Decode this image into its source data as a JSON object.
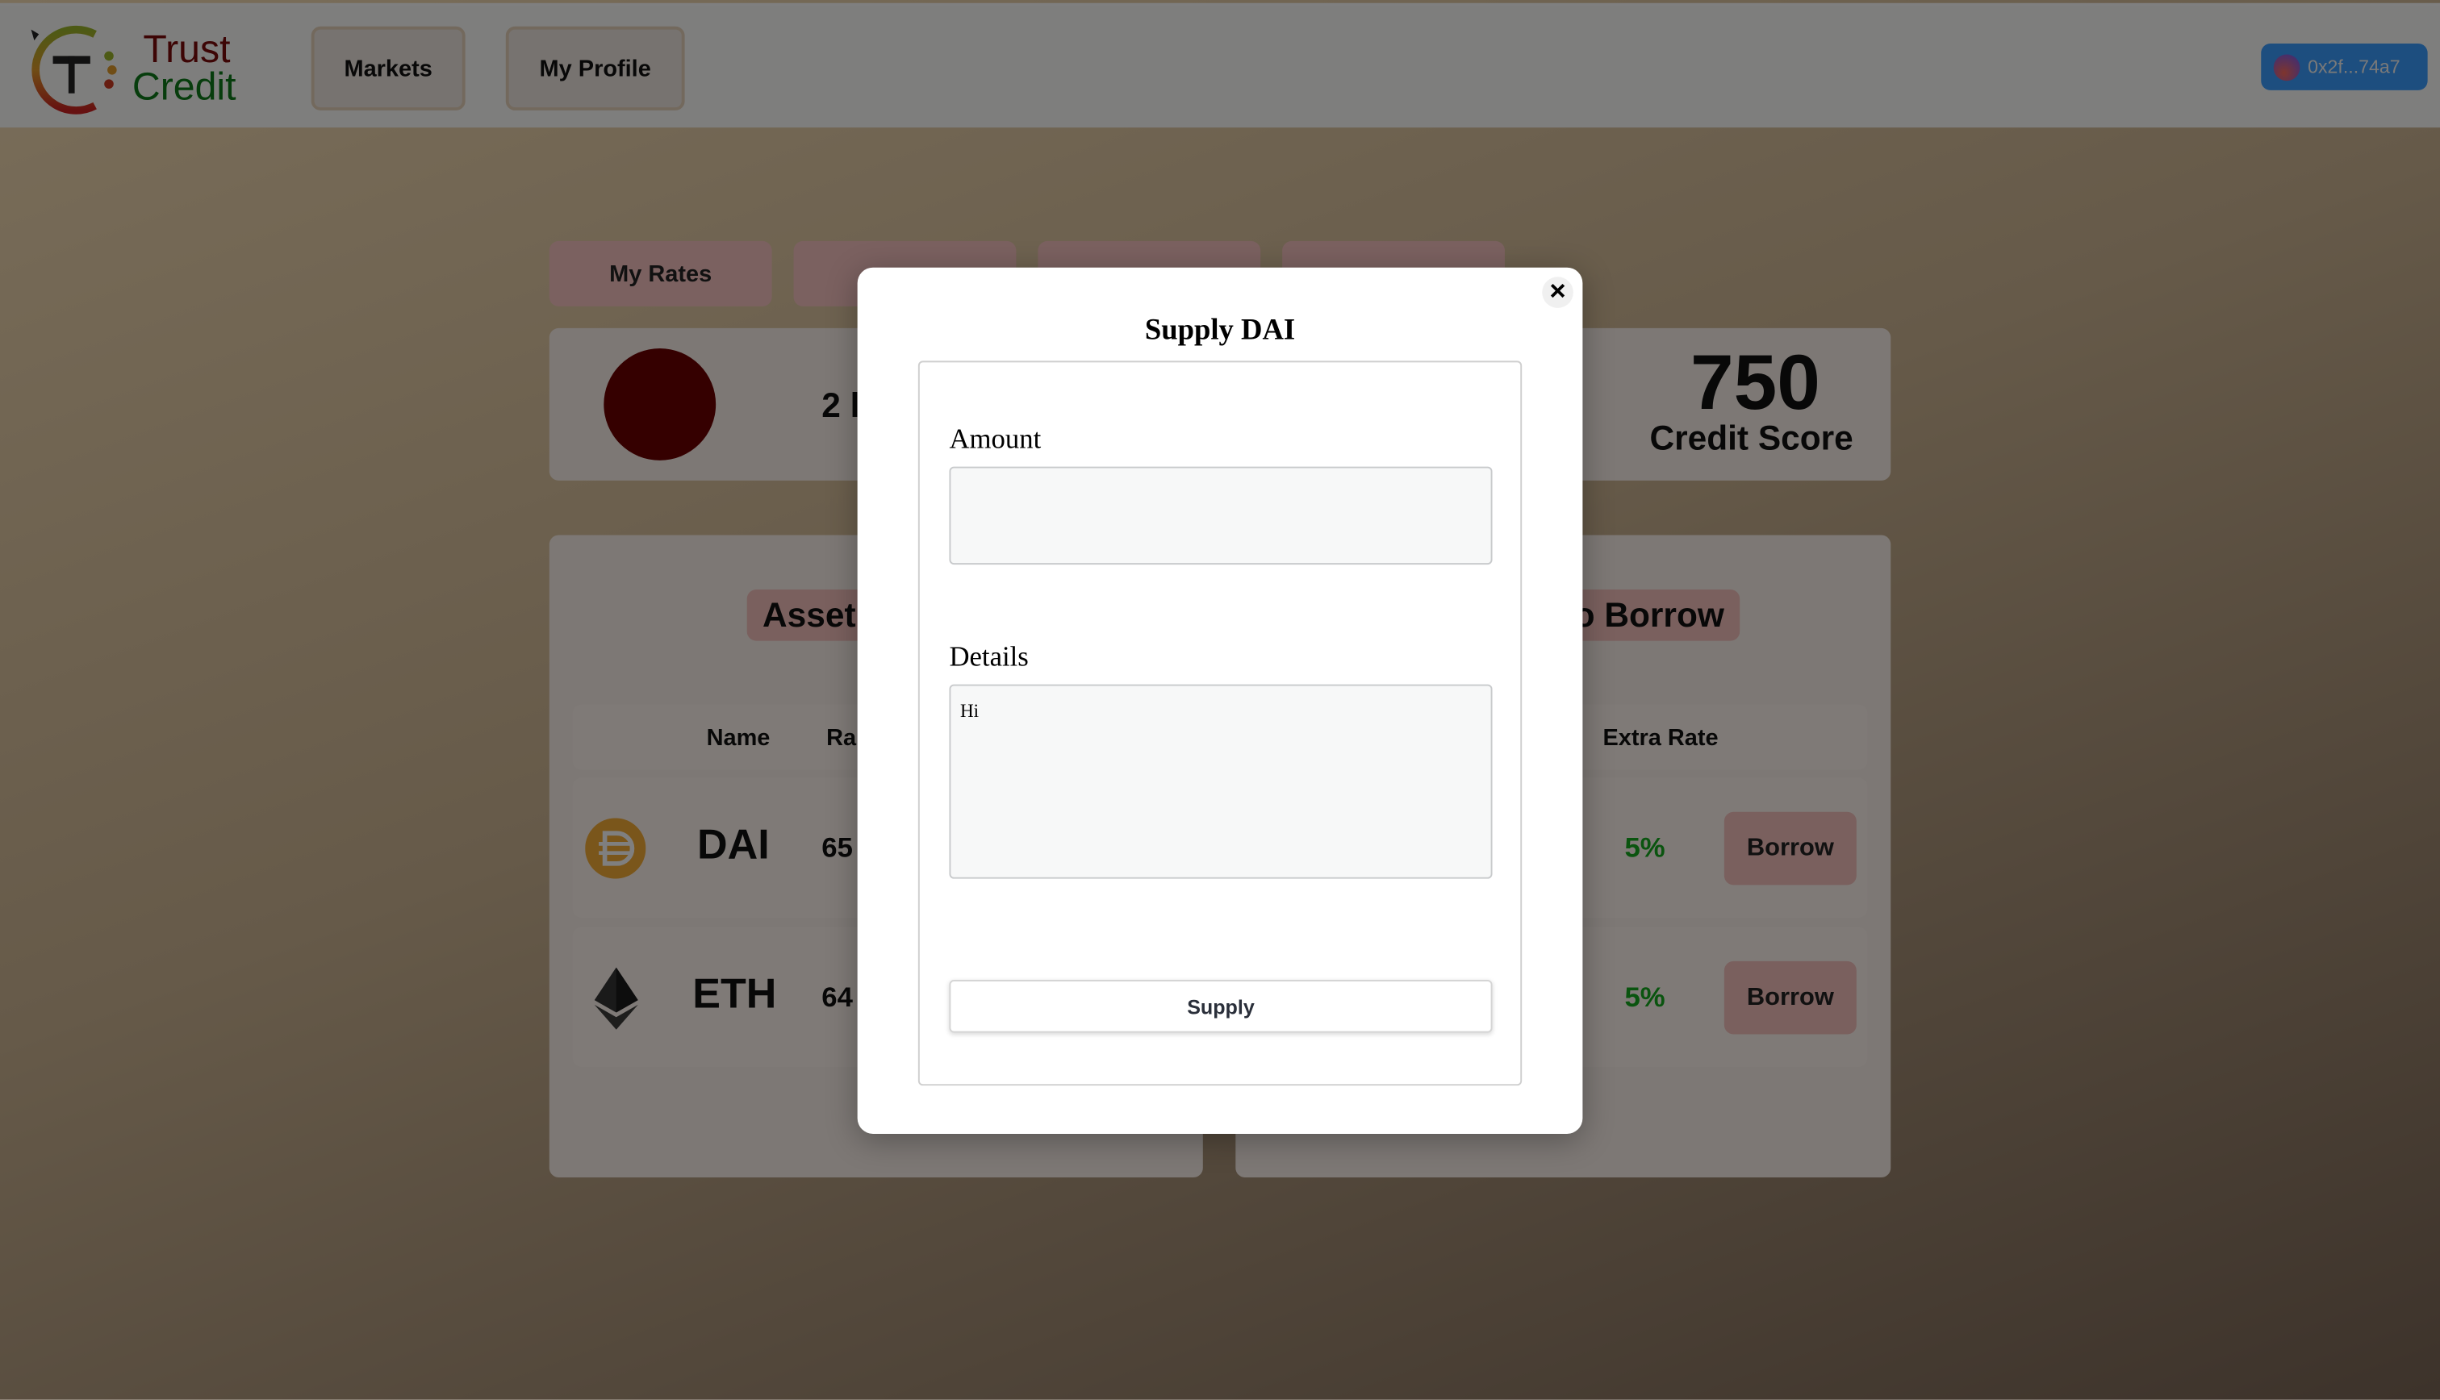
{
  "header": {
    "logo": {
      "line1": "Trust",
      "line2": "Credit"
    },
    "nav": [
      {
        "label": "Markets"
      },
      {
        "label": "My Profile"
      }
    ],
    "wallet": {
      "address": "0x2f...74a7",
      "color": "#3b9cff"
    }
  },
  "tabs": [
    {
      "label": "My Rates"
    },
    {
      "label": ""
    },
    {
      "label": ""
    },
    {
      "label": ""
    }
  ],
  "profile": {
    "partial_text": "2 l",
    "score": "750",
    "score_label": "Credit Score"
  },
  "assets_panel": {
    "title": "Asset",
    "columns": [
      "Name",
      "Ra"
    ],
    "rows": [
      {
        "icon": "dai-icon",
        "name": "DAI",
        "rate": "65"
      },
      {
        "icon": "eth-icon",
        "name": "ETH",
        "rate": "64"
      }
    ]
  },
  "borrow_panel": {
    "title": "o Borrow",
    "columns": [
      "Extra Rate"
    ],
    "rows": [
      {
        "extra_rate": "5%",
        "action": "Borrow"
      },
      {
        "extra_rate": "5%",
        "action": "Borrow"
      }
    ]
  },
  "modal": {
    "title": "Supply DAI",
    "close": "×",
    "amount_label": "Amount",
    "amount_value": "",
    "details_label": "Details",
    "details_value": "Hi",
    "submit": "Supply"
  },
  "colors": {
    "positive": "#14a81e",
    "accent_pink": "#f6c3c0"
  }
}
